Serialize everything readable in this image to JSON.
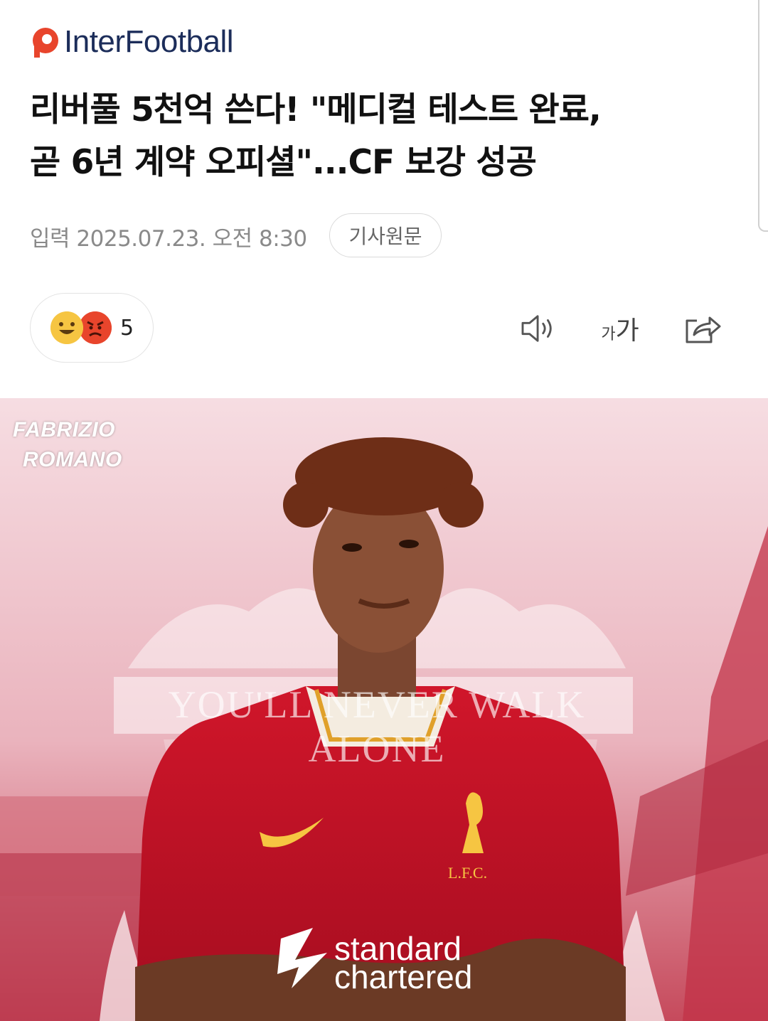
{
  "header": {
    "logo_text": "InterFootball",
    "logo_icon": "p-logo-icon"
  },
  "article": {
    "title_line1": "리버풀 5천억 쓴다! \"메디컬 테스트 완료,",
    "title_line2": "곧 6년 계약 오피셜\"...CF 보강 성공",
    "date": "입력 2025.07.23. 오전 8:30",
    "original_button": "기사원문"
  },
  "toolbar": {
    "reaction_count": "5",
    "reaction_icons": [
      "happy-face-icon",
      "angry-face-icon"
    ],
    "font_small": "가",
    "font_large": "가",
    "icons": [
      "speaker-icon",
      "font-size-icon",
      "share-icon"
    ]
  },
  "hero": {
    "watermark_line1": "FABRIZIO",
    "watermark_line2": "ROMANO",
    "banner_text": "YOU'LL NEVER WALK ALONE",
    "crest_text": "L.F.C.",
    "sponsor_line1": "standard",
    "sponsor_line2": "chartered"
  },
  "colors": {
    "brand": "#1c2d5a",
    "logo_accent": "#e8452c",
    "kit_red": "#c8102e",
    "kit_yellow": "#f6c542"
  }
}
